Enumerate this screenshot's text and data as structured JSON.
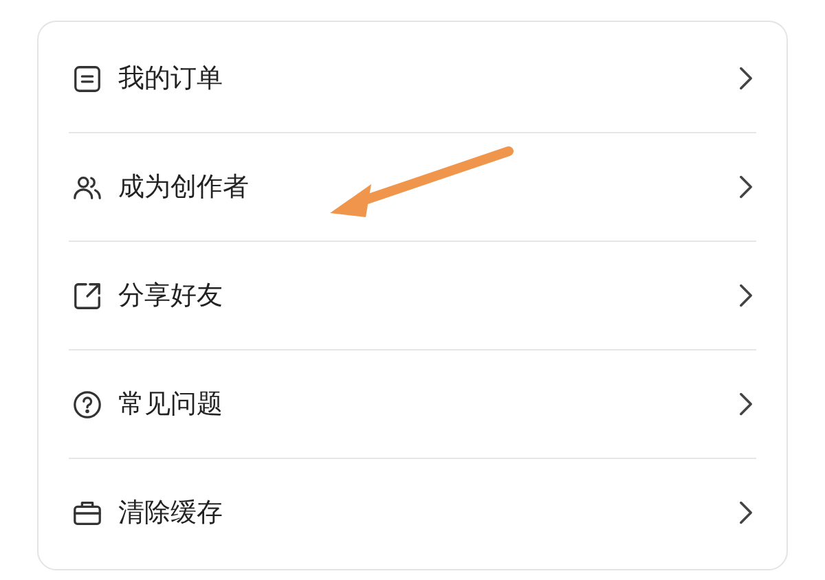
{
  "menu": {
    "items": [
      {
        "kind": "orders",
        "label": "我的订单"
      },
      {
        "kind": "creator",
        "label": "成为创作者"
      },
      {
        "kind": "share",
        "label": "分享好友"
      },
      {
        "kind": "faq",
        "label": "常见问题"
      },
      {
        "kind": "cache",
        "label": "清除缓存"
      }
    ]
  }
}
